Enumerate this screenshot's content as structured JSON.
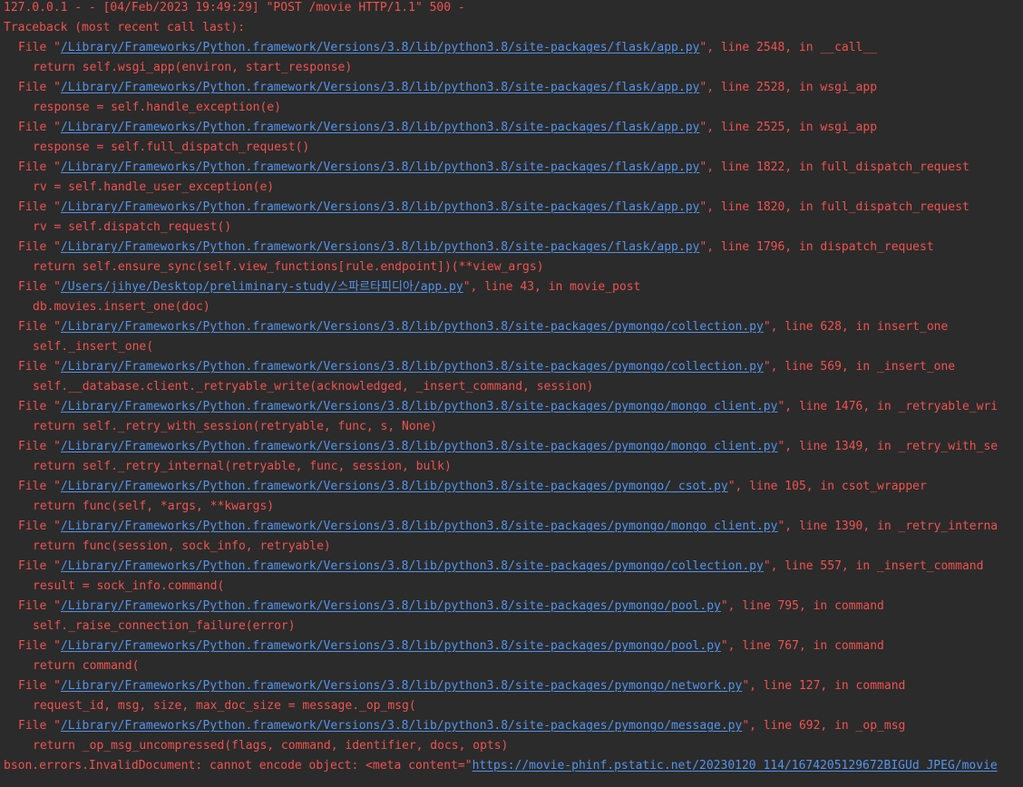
{
  "request_log": {
    "prefix": "127.0.0.1 - - [04/Feb/2023 19:49:29] ",
    "request": "\"POST /movie HTTP/1.1\"",
    "suffix": " 500 -"
  },
  "traceback_header": "Traceback (most recent call last):",
  "frames": [
    {
      "path": "/Library/Frameworks/Python.framework/Versions/3.8/lib/python3.8/site-packages/flask/app.py",
      "location": "\", line 2548, in __call__",
      "code": "return self.wsgi_app(environ, start_response)"
    },
    {
      "path": "/Library/Frameworks/Python.framework/Versions/3.8/lib/python3.8/site-packages/flask/app.py",
      "location": "\", line 2528, in wsgi_app",
      "code": "response = self.handle_exception(e)"
    },
    {
      "path": "/Library/Frameworks/Python.framework/Versions/3.8/lib/python3.8/site-packages/flask/app.py",
      "location": "\", line 2525, in wsgi_app",
      "code": "response = self.full_dispatch_request()"
    },
    {
      "path": "/Library/Frameworks/Python.framework/Versions/3.8/lib/python3.8/site-packages/flask/app.py",
      "location": "\", line 1822, in full_dispatch_request",
      "code": "rv = self.handle_user_exception(e)"
    },
    {
      "path": "/Library/Frameworks/Python.framework/Versions/3.8/lib/python3.8/site-packages/flask/app.py",
      "location": "\", line 1820, in full_dispatch_request",
      "code": "rv = self.dispatch_request()"
    },
    {
      "path": "/Library/Frameworks/Python.framework/Versions/3.8/lib/python3.8/site-packages/flask/app.py",
      "location": "\", line 1796, in dispatch_request",
      "code": "return self.ensure_sync(self.view_functions[rule.endpoint])(**view_args)"
    },
    {
      "path": "/Users/jihye/Desktop/preliminary-study/스파르타피디아/app.py",
      "location": "\", line 43, in movie_post",
      "code": "db.movies.insert_one(doc)"
    },
    {
      "path": "/Library/Frameworks/Python.framework/Versions/3.8/lib/python3.8/site-packages/pymongo/collection.py",
      "location": "\", line 628, in insert_one",
      "code": "self._insert_one("
    },
    {
      "path": "/Library/Frameworks/Python.framework/Versions/3.8/lib/python3.8/site-packages/pymongo/collection.py",
      "location": "\", line 569, in _insert_one",
      "code": "self.__database.client._retryable_write(acknowledged, _insert_command, session)"
    },
    {
      "path": "/Library/Frameworks/Python.framework/Versions/3.8/lib/python3.8/site-packages/pymongo/mongo_client.py",
      "location": "\", line 1476, in _retryable_wri",
      "code": "return self._retry_with_session(retryable, func, s, None)"
    },
    {
      "path": "/Library/Frameworks/Python.framework/Versions/3.8/lib/python3.8/site-packages/pymongo/mongo_client.py",
      "location": "\", line 1349, in _retry_with_se",
      "code": "return self._retry_internal(retryable, func, session, bulk)"
    },
    {
      "path": "/Library/Frameworks/Python.framework/Versions/3.8/lib/python3.8/site-packages/pymongo/_csot.py",
      "location": "\", line 105, in csot_wrapper",
      "code": "return func(self, *args, **kwargs)"
    },
    {
      "path": "/Library/Frameworks/Python.framework/Versions/3.8/lib/python3.8/site-packages/pymongo/mongo_client.py",
      "location": "\", line 1390, in _retry_interna",
      "code": "return func(session, sock_info, retryable)"
    },
    {
      "path": "/Library/Frameworks/Python.framework/Versions/3.8/lib/python3.8/site-packages/pymongo/collection.py",
      "location": "\", line 557, in _insert_command",
      "code": "result = sock_info.command("
    },
    {
      "path": "/Library/Frameworks/Python.framework/Versions/3.8/lib/python3.8/site-packages/pymongo/pool.py",
      "location": "\", line 795, in command",
      "code": "self._raise_connection_failure(error)"
    },
    {
      "path": "/Library/Frameworks/Python.framework/Versions/3.8/lib/python3.8/site-packages/pymongo/pool.py",
      "location": "\", line 767, in command",
      "code": "return command("
    },
    {
      "path": "/Library/Frameworks/Python.framework/Versions/3.8/lib/python3.8/site-packages/pymongo/network.py",
      "location": "\", line 127, in command",
      "code": "request_id, msg, size, max_doc_size = message._op_msg("
    },
    {
      "path": "/Library/Frameworks/Python.framework/Versions/3.8/lib/python3.8/site-packages/pymongo/message.py",
      "location": "\", line 692, in _op_msg",
      "code": "return _op_msg_uncompressed(flags, command, identifier, docs, opts)"
    }
  ],
  "file_prefix": "File \"",
  "error": {
    "text": "bson.errors.InvalidDocument: cannot encode object: <meta content=\"",
    "url": "https://movie-phinf.pstatic.net/20230120_114/1674205129672BIGUd_JPEG/movie"
  },
  "colors": {
    "background": "#2b2b2b",
    "error_text": "#f0524f",
    "link": "#5394ec"
  }
}
